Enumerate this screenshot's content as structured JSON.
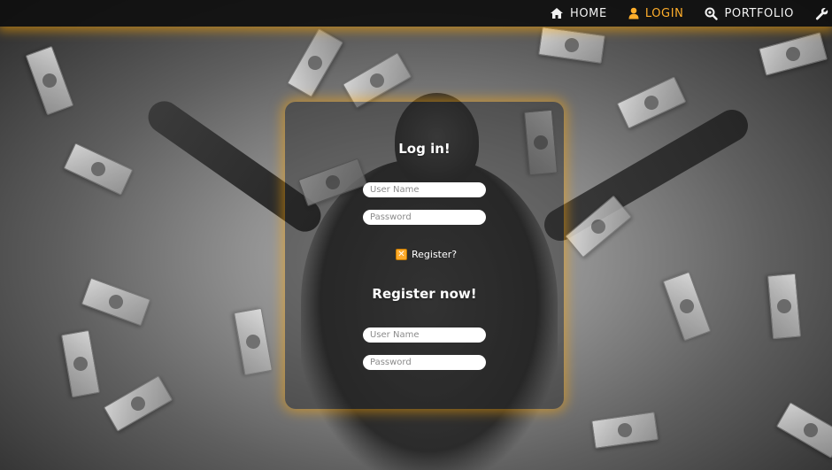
{
  "nav": {
    "items": [
      {
        "label": "HOME",
        "icon": "home-icon"
      },
      {
        "label": "LOGIN",
        "icon": "user-icon",
        "active": true
      },
      {
        "label": "PORTFOLIO",
        "icon": "search-icon"
      },
      {
        "label": "",
        "icon": "wrench-icon"
      }
    ],
    "accent_color": "#ffae2b"
  },
  "login": {
    "title": "Log in!",
    "username_placeholder": "User Name",
    "password_placeholder": "Password"
  },
  "register_toggle": {
    "label": "Register?",
    "checked": true
  },
  "register": {
    "title": "Register now!",
    "username_placeholder": "User Name",
    "password_placeholder": "Password"
  }
}
